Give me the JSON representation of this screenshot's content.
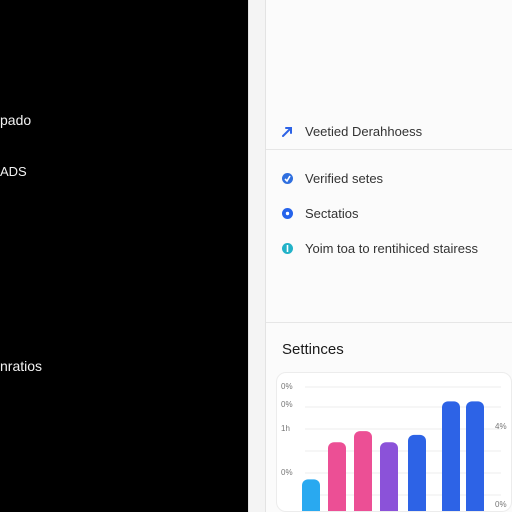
{
  "left": {
    "labels": [
      "pado",
      "ADS",
      "nratios"
    ]
  },
  "list": {
    "header": "Veetied Derahhoess",
    "items": [
      {
        "label": "Verified setes",
        "color": "#2f6fdf"
      },
      {
        "label": "Sectatios",
        "color": "#2563eb"
      },
      {
        "label": "Yoim toa to rentihiced stairess",
        "color": "#22b2c8"
      }
    ]
  },
  "chart_card": {
    "title": "Settinces"
  },
  "chart_data": {
    "type": "bar",
    "values": [
      17,
      37,
      43,
      37,
      41,
      59,
      59
    ],
    "colors": [
      "#29a9f0",
      "#ec4f95",
      "#ec4f95",
      "#8b52d9",
      "#2d63e6",
      "#2d63e6",
      "#2d63e6"
    ],
    "left_ticks": [
      "0%",
      "0%",
      "1h",
      "0%"
    ],
    "right_ticks": [
      "4%",
      "0%"
    ],
    "ylim": [
      0,
      70
    ]
  },
  "accent": "#2d63e6"
}
